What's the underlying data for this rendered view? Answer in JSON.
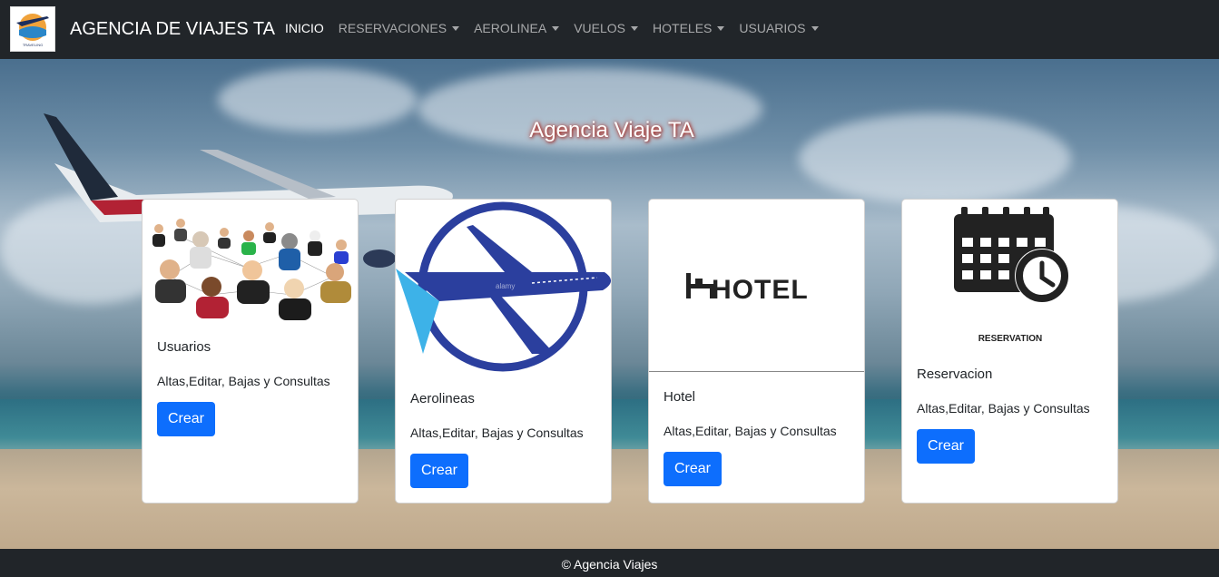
{
  "navbar": {
    "brand": "AGENCIA DE VIAJES TA",
    "logo_text": "TRAVELING",
    "items": [
      {
        "label": "INICIO",
        "active": true,
        "dropdown": false
      },
      {
        "label": "RESERVACIONES",
        "active": false,
        "dropdown": true
      },
      {
        "label": "AEROLINEA",
        "active": false,
        "dropdown": true
      },
      {
        "label": "VUELOS",
        "active": false,
        "dropdown": true
      },
      {
        "label": "HOTELES",
        "active": false,
        "dropdown": true
      },
      {
        "label": "USUARIOS",
        "active": false,
        "dropdown": true
      }
    ]
  },
  "hero": {
    "title": "Agencia Viaje TA"
  },
  "cards": [
    {
      "title": "Usuarios",
      "text": "Altas,Editar, Bajas y Consultas",
      "button": "Crear",
      "image": "users-network"
    },
    {
      "title": "Aerolineas",
      "text": "Altas,Editar, Bajas y Consultas",
      "button": "Crear",
      "image": "airline-logo",
      "watermark": "alamy"
    },
    {
      "title": "Hotel",
      "text": "Altas,Editar, Bajas y Consultas",
      "button": "Crear",
      "image": "hotel-logo",
      "logo_text": "HOTEL"
    },
    {
      "title": "Reservacion",
      "text": "Altas,Editar, Bajas y Consultas",
      "button": "Crear",
      "image": "calendar-clock",
      "caption": "RESERVATION"
    }
  ],
  "footer": {
    "text": "© Agencia Viajes"
  },
  "colors": {
    "navbar_bg": "#212529",
    "primary_button": "#0d6efd",
    "airline_blue": "#2b3f9e",
    "title_glow": "#c0392b"
  }
}
